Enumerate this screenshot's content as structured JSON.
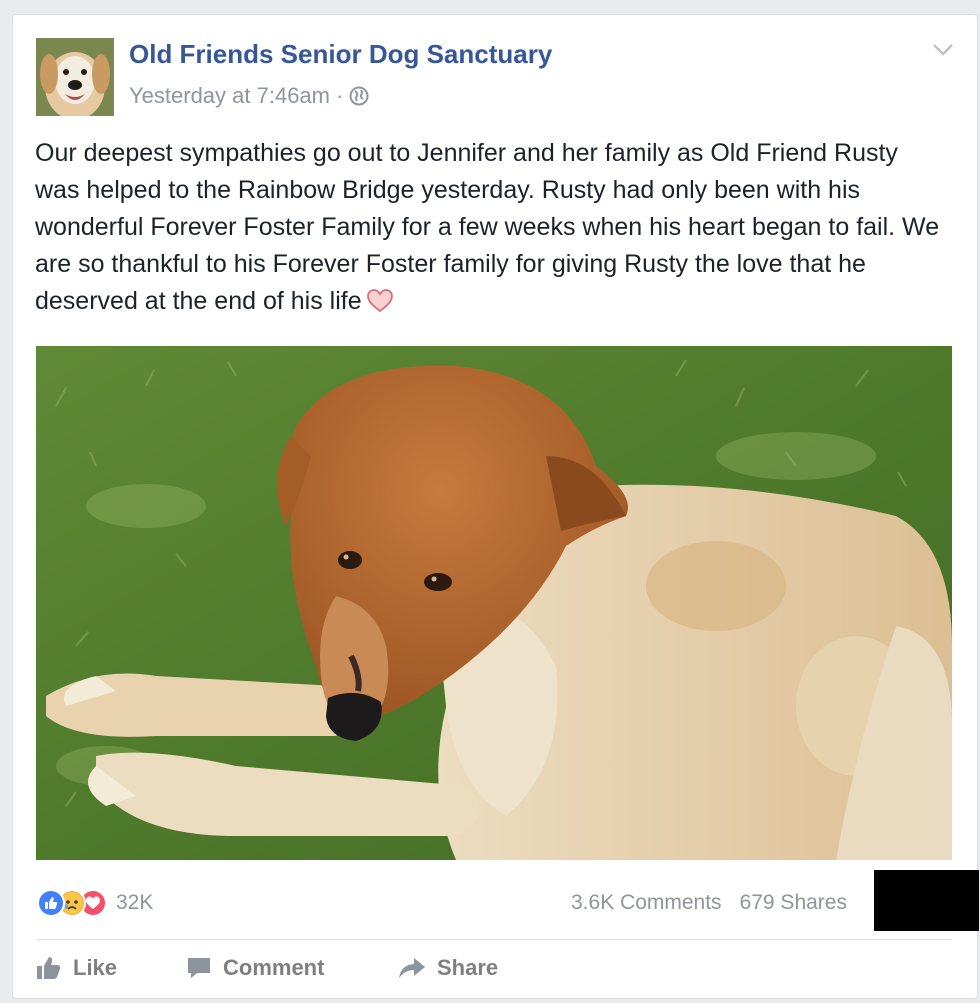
{
  "post": {
    "page_name": "Old Friends Senior Dog Sanctuary",
    "timestamp": "Yesterday at 7:46am",
    "separator": "·",
    "privacy_icon": "globe-icon",
    "menu_icon": "chevron-down-icon",
    "text": "Our deepest sympathies go out to Jennifer and her family as Old Friend Rusty was helped to the Rainbow Bridge yesterday. Rusty had only been with his wonderful Forever Foster Family for a few weeks when his heart began to fail. We are so thankful to his Forever Foster family for giving Rusty the love that he deserved at the end of his life",
    "text_emoji": "heart-icon"
  },
  "reactions": {
    "icons": [
      "like-icon",
      "sad-icon",
      "love-icon"
    ],
    "count": "32K",
    "comments": "3.6K Comments",
    "shares": "679 Shares"
  },
  "actions": {
    "like_label": "Like",
    "comment_label": "Comment",
    "share_label": "Share"
  },
  "colors": {
    "link": "#365899",
    "meta": "#90949c",
    "like": "#4080ff",
    "sad": "#f7b125",
    "love": "#f25268"
  }
}
